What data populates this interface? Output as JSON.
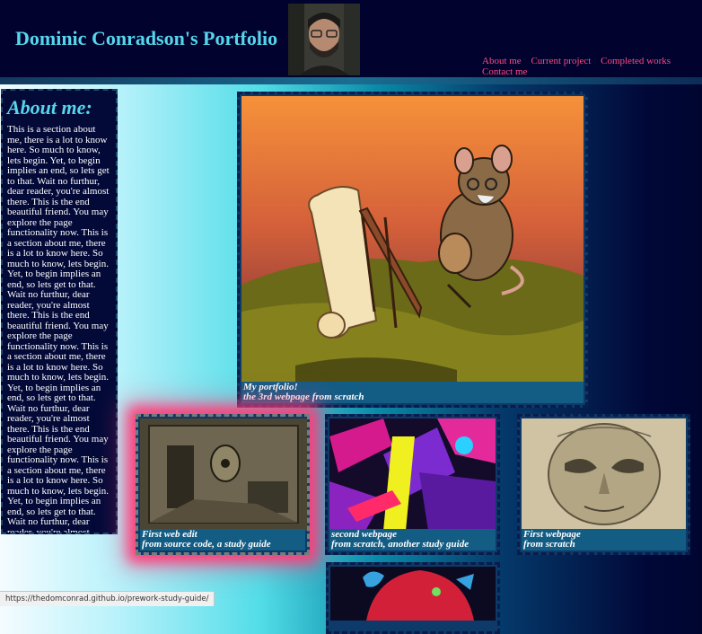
{
  "header": {
    "title": "Dominic Conradson's Portfolio",
    "nav": [
      "About me",
      "Current project",
      "Completed works",
      "Contact me"
    ]
  },
  "about": {
    "heading": "About me:",
    "text": "This is a section about me, there is a lot to know here. So much to know, lets begin. Yet, to begin implies an end, so lets get to that. Wait no furthur, dear reader, you're almost there. This is the end beautiful friend. You may explore the page functionality now. This is a section about me, there is a lot to know here. So much to know, lets begin. Yet, to begin implies an end, so lets get to that. Wait no furthur, dear reader, you're almost there. This is the end beautiful friend. You may explore the page functionality now. This is a section about me, there is a lot to know here. So much to know, lets begin. Yet, to begin implies an end, so lets get to that. Wait no furthur, dear reader, you're almost there. This is the end beautiful friend. You may explore the page functionality now. This is a section about me, there is a lot to know here. So much to know, lets begin. Yet, to begin implies an end, so lets get to that. Wait no furthur, dear reader, you're almost there. This is the end beautiful friend. You may explore the page functionality now."
  },
  "projects": [
    {
      "line1": "My portfolio!",
      "line2": "the 3rd webpage from scratch"
    },
    {
      "line1": "First web edit",
      "line2": "from source code, a study guide"
    },
    {
      "line1": "second webpage",
      "line2": "from scratch, another study guide"
    },
    {
      "line1": "First webpage",
      "line2": "from scratch"
    }
  ],
  "status_url": "https://thedomconrad.github.io/prework-study-guide/",
  "colors": {
    "title": "#56d6ec",
    "nav_link": "#ff4a83",
    "header_bg": "#01022e",
    "caption_bg": "#135d85"
  }
}
